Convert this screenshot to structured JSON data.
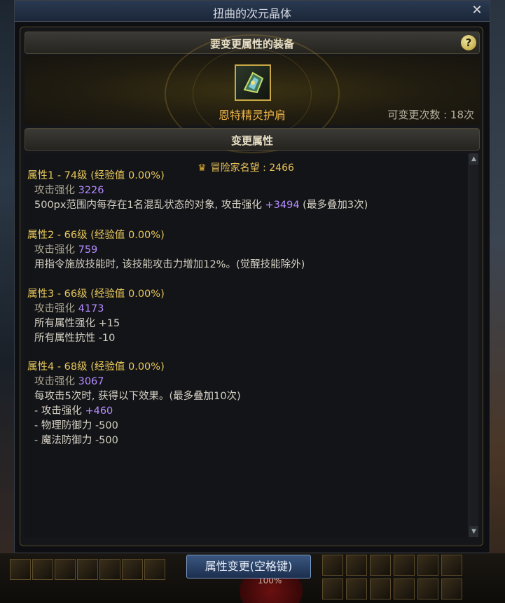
{
  "window": {
    "title": "扭曲的次元晶体",
    "close": "✕"
  },
  "equip_section": {
    "header": "要变更属性的装备",
    "help": "?",
    "item_name": "恩特精灵护肩",
    "change_label": "可变更次数 : 18次"
  },
  "change_section": {
    "header": "变更属性"
  },
  "renown": "冒险家名望 : 2466",
  "attributes": [
    {
      "head": "属性1 - 74级 (经验值 0.00%)",
      "lines": [
        {
          "pre": "攻击强化 ",
          "val": "3226",
          "post": "",
          "dim": true
        },
        {
          "pre": "500px范围内每存在1名混乱状态的对象, 攻击强化 ",
          "val": "+3494",
          "post": " (最多叠加3次)",
          "dim": false
        }
      ]
    },
    {
      "head": "属性2 - 66级 (经验值 0.00%)",
      "lines": [
        {
          "pre": "攻击强化 ",
          "val": "759",
          "post": "",
          "dim": true
        },
        {
          "pre": "用指令施放技能时, 该技能攻击力增加12%。(觉醒技能除外)",
          "val": "",
          "post": "",
          "dim": false
        }
      ]
    },
    {
      "head": "属性3 - 66级 (经验值 0.00%)",
      "lines": [
        {
          "pre": "攻击强化 ",
          "val": "4173",
          "post": "",
          "dim": true
        },
        {
          "pre": "所有属性强化 +15",
          "val": "",
          "post": "",
          "dim": false
        },
        {
          "pre": "所有属性抗性 -10",
          "val": "",
          "post": "",
          "dim": false
        }
      ]
    },
    {
      "head": "属性4 - 68级 (经验值 0.00%)",
      "lines": [
        {
          "pre": "攻击强化 ",
          "val": "3067",
          "post": "",
          "dim": true
        },
        {
          "pre": "每攻击5次时, 获得以下效果。(最多叠加10次)",
          "val": "",
          "post": "",
          "dim": false
        },
        {
          "pre": "- 攻击强化 ",
          "val": "+460",
          "post": "",
          "dim": false
        },
        {
          "pre": "- 物理防御力 -500",
          "val": "",
          "post": "",
          "dim": false
        },
        {
          "pre": "- 魔法防御力 -500",
          "val": "",
          "post": "",
          "dim": false
        }
      ]
    }
  ],
  "bottom": {
    "confirm_button": "属性变更(空格键)",
    "hp_percent": "100%"
  },
  "colors": {
    "gold_heading": "#e7c75a",
    "item_orange": "#f0b64a",
    "stat_purple": "#b48cff",
    "button_blue": "#2a4468"
  }
}
